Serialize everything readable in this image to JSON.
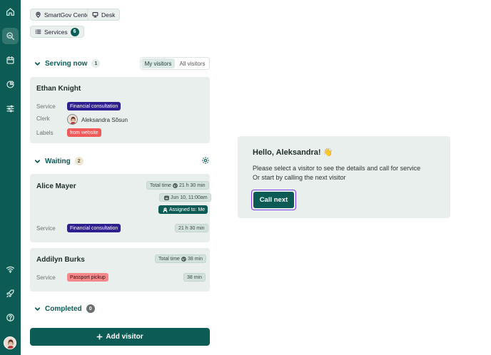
{
  "header": {
    "location_label": "SmartGov Center",
    "desk_label": "Desk",
    "services_label": "Services",
    "services_count": "6"
  },
  "serving": {
    "title": "Serving now",
    "count": "1",
    "tabs": [
      "My visitors",
      "All visitors"
    ],
    "active_tab": "My visitors",
    "visitor": {
      "name": "Ethan Knight",
      "service_label": "Service",
      "service": "Financial consultation",
      "clerk_label": "Clerk",
      "clerk": "Aleksandra Sõsun",
      "labels_label": "Labels",
      "label": "from website"
    }
  },
  "waiting": {
    "title": "Waiting",
    "count": "2",
    "visitors": [
      {
        "name": "Alice Mayer",
        "total_time_label": "Total time",
        "total_time": "21 h 30 min",
        "date": "Jun 10, 11:00am",
        "assigned": "Assigned to: Me",
        "service_label": "Service",
        "service": "Financial consultation",
        "service_time": "21 h 30 min"
      },
      {
        "name": "Addilyn Burks",
        "total_time_label": "Total time",
        "total_time": "38 min",
        "service_label": "Service",
        "service": "Passport pickup",
        "service_time": "38 min"
      }
    ]
  },
  "completed": {
    "title": "Completed",
    "count": "0"
  },
  "add_visitor_label": "Add visitor",
  "welcome": {
    "title": "Hello, Aleksandra! 👋",
    "line1": "Please select a visitor to see the details and call for service",
    "line2": "Or start by calling the next visitor",
    "call_next_label": "Call next"
  },
  "colors": {
    "brand": "#0c5c55",
    "service_purple": "#2e1f8f",
    "label_red": "#f25a5a",
    "focus_outline": "#7c3aed"
  }
}
